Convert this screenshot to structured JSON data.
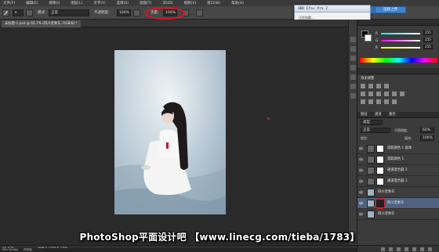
{
  "menu": {
    "items": [
      "文件(F)",
      "编辑(E)",
      "图像(I)",
      "图层(L)",
      "文字(Y)",
      "选择(S)",
      "滤镜(T)",
      "3D(D)",
      "视图(V)",
      "窗口(W)",
      "帮助(H)"
    ]
  },
  "options_bar": {
    "mode_label": "模式:",
    "mode_value": "正常",
    "opacity_label": "不透明度:",
    "opacity_value": "100%",
    "flow_label": "流量:",
    "flow_value": "100%",
    "highlight_color": "#e0141e"
  },
  "document_tab": {
    "title": "未标题-1.psd @ 66.7% (四川老帅车, RGB/8) *"
  },
  "status_bar": {
    "zoom": "66.67%",
    "doc_info": "文档:1.07M/6.18M"
  },
  "bottom_tabs": [
    "Mini Bridge",
    "时间轴"
  ],
  "dialog": {
    "title": "HDR Efex Pro 2",
    "line1": "正在加载...",
    "line2": "请稍候",
    "button": "选择上传"
  },
  "color_panel": {
    "r_value": "255",
    "g_value": "255",
    "b_value": "255"
  },
  "adjustments_panel": {
    "header": "添加调整"
  },
  "layers_panel": {
    "tabs": [
      "图层",
      "通道",
      "路径"
    ],
    "filter_label": "类型",
    "blend_mode": "正常",
    "opacity_label": "不透明度:",
    "opacity_value": "60%",
    "lock_label": "锁定:",
    "fill_label": "填充:",
    "fill_value": "100%",
    "layers": [
      {
        "name": "选取颜色 1 副本",
        "selected": false
      },
      {
        "name": "选取颜色 1",
        "selected": false
      },
      {
        "name": "通道混合器 2",
        "selected": false
      },
      {
        "name": "通道混合器 1",
        "selected": false
      },
      {
        "name": "四川老帅车",
        "selected": false
      },
      {
        "name": "四川老帅车",
        "selected": true
      },
      {
        "name": "四川老帅车",
        "selected": false
      }
    ]
  },
  "watermark": {
    "text": "PhotoShop平面设计吧 【www.linecg.com/tieba/1783】"
  }
}
